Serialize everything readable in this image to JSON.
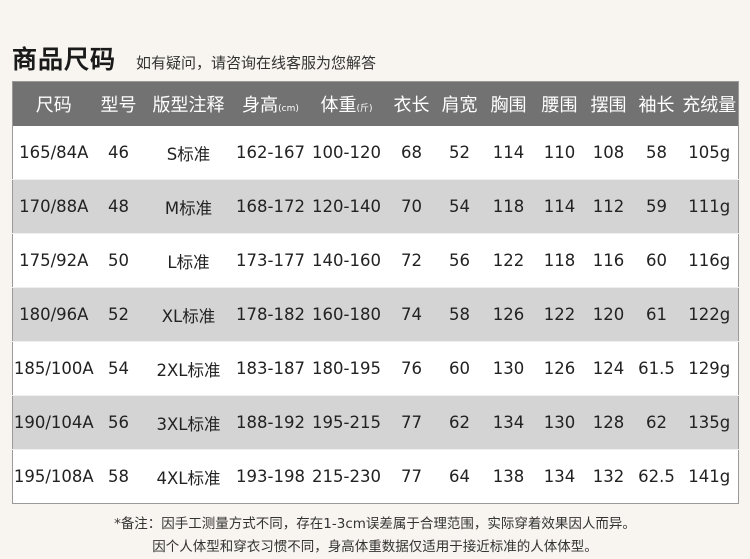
{
  "header": {
    "title": "商品尺码",
    "subtitle": "如有疑问，请咨询在线客服为您解答"
  },
  "table": {
    "columns": [
      {
        "label": "尺码",
        "unit": ""
      },
      {
        "label": "型号",
        "unit": ""
      },
      {
        "label": "版型注释",
        "unit": ""
      },
      {
        "label": "身高",
        "unit": "(cm)"
      },
      {
        "label": "体重",
        "unit": "(斤)"
      },
      {
        "label": "衣长",
        "unit": ""
      },
      {
        "label": "肩宽",
        "unit": ""
      },
      {
        "label": "胸围",
        "unit": ""
      },
      {
        "label": "腰围",
        "unit": ""
      },
      {
        "label": "摆围",
        "unit": ""
      },
      {
        "label": "袖长",
        "unit": ""
      },
      {
        "label": "充绒量",
        "unit": ""
      }
    ],
    "rows": [
      [
        "165/84A",
        "46",
        "S标准",
        "162-167",
        "100-120",
        "68",
        "52",
        "114",
        "110",
        "108",
        "58",
        "105g"
      ],
      [
        "170/88A",
        "48",
        "M标准",
        "168-172",
        "120-140",
        "70",
        "54",
        "118",
        "114",
        "112",
        "59",
        "111g"
      ],
      [
        "175/92A",
        "50",
        "L标准",
        "173-177",
        "140-160",
        "72",
        "56",
        "122",
        "118",
        "116",
        "60",
        "116g"
      ],
      [
        "180/96A",
        "52",
        "XL标准",
        "178-182",
        "160-180",
        "74",
        "58",
        "126",
        "122",
        "120",
        "61",
        "122g"
      ],
      [
        "185/100A",
        "54",
        "2XL标准",
        "183-187",
        "180-195",
        "76",
        "60",
        "130",
        "126",
        "124",
        "61.5",
        "129g"
      ],
      [
        "190/104A",
        "56",
        "3XL标准",
        "188-192",
        "195-215",
        "77",
        "62",
        "134",
        "130",
        "128",
        "62",
        "135g"
      ],
      [
        "195/108A",
        "58",
        "4XL标准",
        "193-198",
        "215-230",
        "77",
        "64",
        "138",
        "134",
        "132",
        "62.5",
        "141g"
      ]
    ]
  },
  "notes": {
    "line1": "*备注：因手工测量方式不同，存在1-3cm误差属于合理范围，实际穿着效果因人而异。",
    "line2": "因个人体型和穿衣习惯不同，身高体重数据仅适用于接近标准的人体体型。"
  }
}
